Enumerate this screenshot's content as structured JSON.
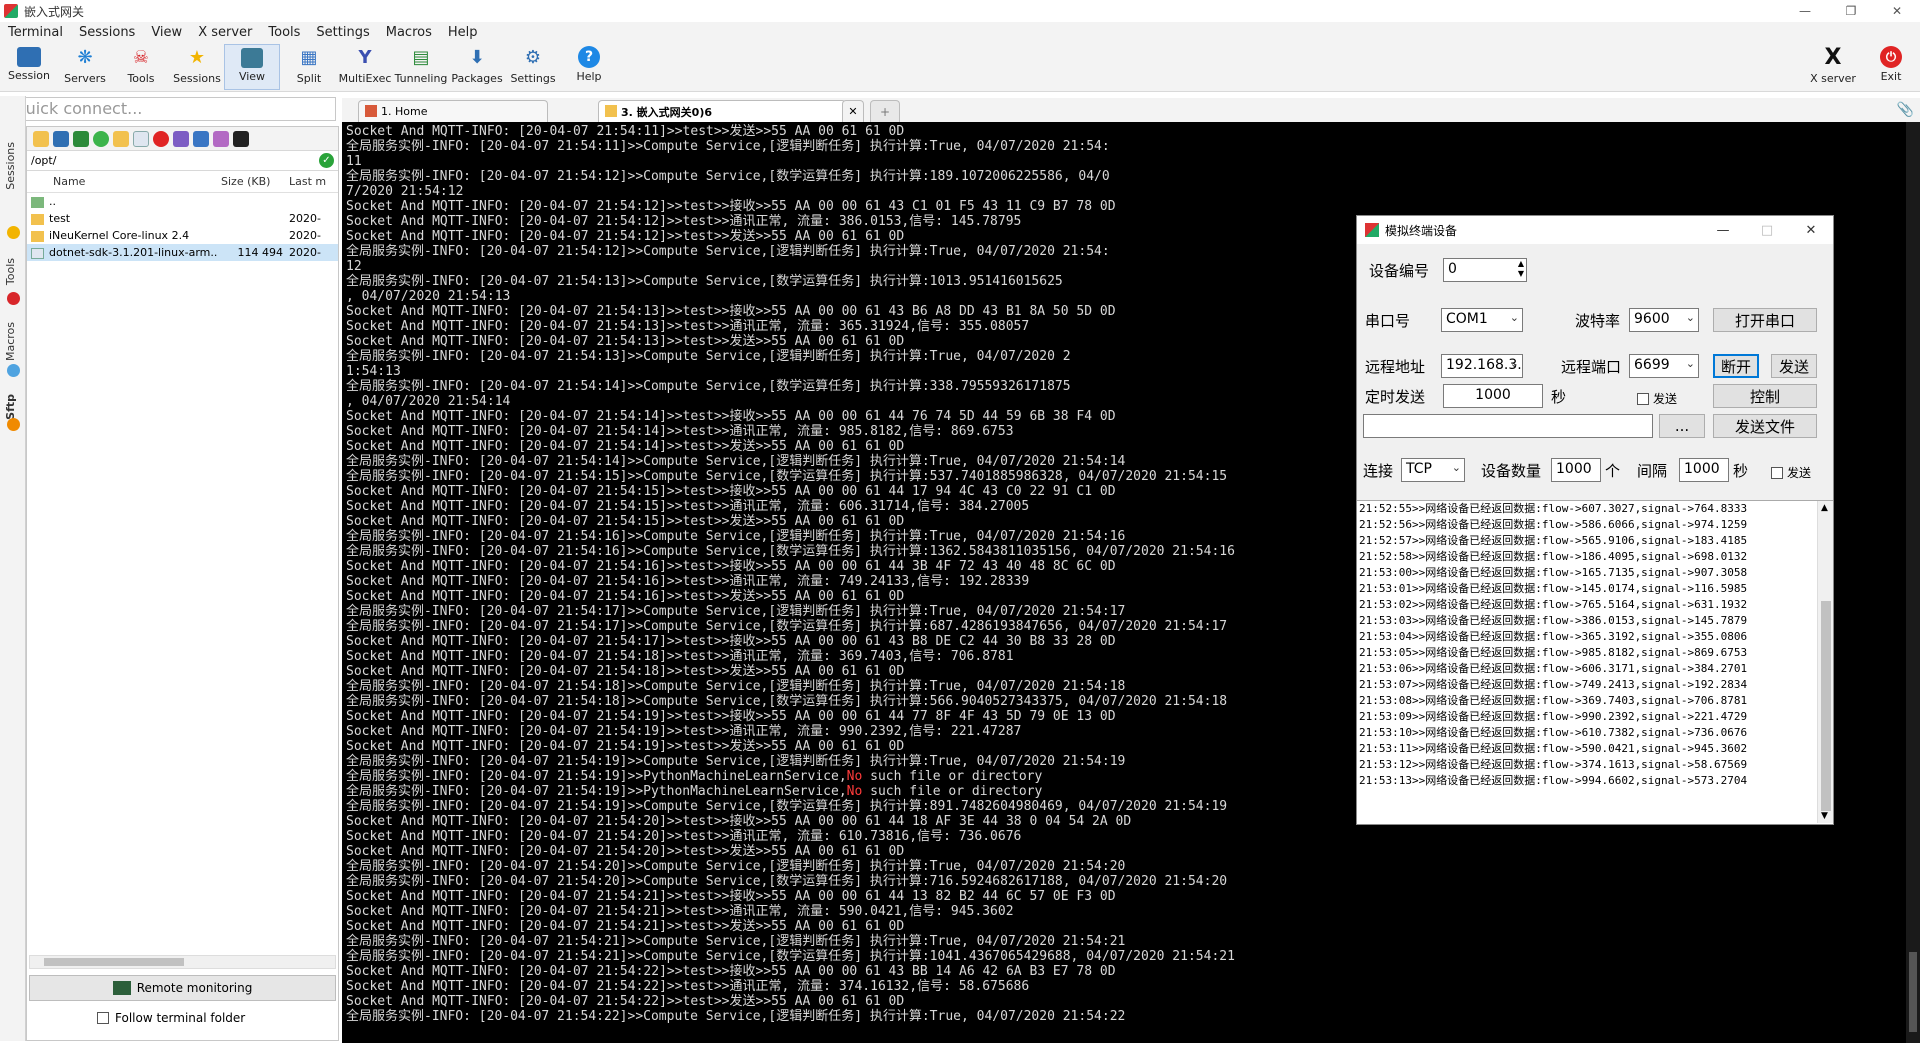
{
  "window": {
    "title": "嵌入式网关"
  },
  "menu": [
    "Terminal",
    "Sessions",
    "View",
    "X server",
    "Tools",
    "Settings",
    "Macros",
    "Help"
  ],
  "toolbar": {
    "session": "Session",
    "servers": "Servers",
    "tools": "Tools",
    "sessions": "Sessions",
    "view": "View",
    "split": "Split",
    "multiexec": "MultiExec",
    "tunneling": "Tunneling",
    "packages": "Packages",
    "settings": "Settings",
    "help": "Help",
    "xserver": "X server",
    "exit": "Exit"
  },
  "sidebar": {
    "quick_connect_placeholder": "Quick connect...",
    "vtabs": [
      "Sessions",
      "Tools",
      "Macros",
      "Sftp"
    ],
    "path": "/opt/",
    "columns": {
      "name": "Name",
      "size": "Size (KB)",
      "last": "Last m"
    },
    "files": [
      {
        "name": "..",
        "size": "",
        "last": "",
        "type": "parent"
      },
      {
        "name": "test",
        "size": "",
        "last": "2020-",
        "type": "folder"
      },
      {
        "name": "iNeuKernel Core-linux 2.4",
        "size": "",
        "last": "2020-",
        "type": "folder"
      },
      {
        "name": "dotnet-sdk-3.1.201-linux-arm...",
        "size": "114 494",
        "last": "2020-",
        "type": "file"
      }
    ],
    "remote_monitoring": "Remote monitoring",
    "follow_terminal": "Follow terminal folder"
  },
  "tabs": [
    {
      "label": "1. Home"
    },
    {
      "label": "3. 嵌入式网关0)6"
    }
  ],
  "terminal_lines": [
    "Socket And MQTT-INFO: [20-04-07 21:54:11]>>test>>发送>>55 AA 00 61 61 0D",
    "全局服务实例-INFO: [20-04-07 21:54:11]>>Compute Service,[逻辑判断任务] 执行计算:True, 04/07/2020 21:54:",
    "11",
    "全局服务实例-INFO: [20-04-07 21:54:12]>>Compute Service,[数学运算任务] 执行计算:189.1072006225586, 04/0",
    "7/2020 21:54:12",
    "Socket And MQTT-INFO: [20-04-07 21:54:12]>>test>>接收>>55 AA 00 00 61 43 C1 01 F5 43 11 C9 B7 78 0D",
    "Socket And MQTT-INFO: [20-04-07 21:54:12]>>test>>通讯正常, 流量: 386.0153,信号: 145.78795",
    "Socket And MQTT-INFO: [20-04-07 21:54:12]>>test>>发送>>55 AA 00 61 61 0D",
    "全局服务实例-INFO: [20-04-07 21:54:12]>>Compute Service,[逻辑判断任务] 执行计算:True, 04/07/2020 21:54:",
    "12",
    "全局服务实例-INFO: [20-04-07 21:54:13]>>Compute Service,[数学运算任务] 执行计算:1013.951416015625",
    ", 04/07/2020 21:54:13",
    "Socket And MQTT-INFO: [20-04-07 21:54:13]>>test>>接收>>55 AA 00 00 61 43 B6 A8 DD 43 B1 8A 50 5D 0D",
    "Socket And MQTT-INFO: [20-04-07 21:54:13]>>test>>通讯正常, 流量: 365.31924,信号: 355.08057",
    "Socket And MQTT-INFO: [20-04-07 21:54:13]>>test>>发送>>55 AA 00 61 61 0D",
    "全局服务实例-INFO: [20-04-07 21:54:13]>>Compute Service,[逻辑判断任务] 执行计算:True, 04/07/2020 2",
    "1:54:13",
    "全局服务实例-INFO: [20-04-07 21:54:14]>>Compute Service,[数学运算任务] 执行计算:338.79559326171875",
    ", 04/07/2020 21:54:14",
    "Socket And MQTT-INFO: [20-04-07 21:54:14]>>test>>接收>>55 AA 00 00 61 44 76 74 5D 44 59 6B 38 F4 0D",
    "Socket And MQTT-INFO: [20-04-07 21:54:14]>>test>>通讯正常, 流量: 985.8182,信号: 869.6753",
    "Socket And MQTT-INFO: [20-04-07 21:54:14]>>test>>发送>>55 AA 00 61 61 0D",
    "全局服务实例-INFO: [20-04-07 21:54:14]>>Compute Service,[逻辑判断任务] 执行计算:True, 04/07/2020 21:54:14",
    "全局服务实例-INFO: [20-04-07 21:54:15]>>Compute Service,[数学运算任务] 执行计算:537.7401885986328, 04/07/2020 21:54:15",
    "Socket And MQTT-INFO: [20-04-07 21:54:15]>>test>>接收>>55 AA 00 00 61 44 17 94 4C 43 C0 22 91 C1 0D",
    "Socket And MQTT-INFO: [20-04-07 21:54:15]>>test>>通讯正常, 流量: 606.31714,信号: 384.27005",
    "Socket And MQTT-INFO: [20-04-07 21:54:15]>>test>>发送>>55 AA 00 61 61 0D",
    "全局服务实例-INFO: [20-04-07 21:54:16]>>Compute Service,[逻辑判断任务] 执行计算:True, 04/07/2020 21:54:16",
    "全局服务实例-INFO: [20-04-07 21:54:16]>>Compute Service,[数学运算任务] 执行计算:1362.5843811035156, 04/07/2020 21:54:16",
    "Socket And MQTT-INFO: [20-04-07 21:54:16]>>test>>接收>>55 AA 00 00 61 44 3B 4F 72 43 40 48 8C 6C 0D",
    "Socket And MQTT-INFO: [20-04-07 21:54:16]>>test>>通讯正常, 流量: 749.24133,信号: 192.28339",
    "Socket And MQTT-INFO: [20-04-07 21:54:16]>>test>>发送>>55 AA 00 61 61 0D",
    "全局服务实例-INFO: [20-04-07 21:54:17]>>Compute Service,[逻辑判断任务] 执行计算:True, 04/07/2020 21:54:17",
    "全局服务实例-INFO: [20-04-07 21:54:17]>>Compute Service,[数学运算任务] 执行计算:687.4286193847656, 04/07/2020 21:54:17",
    "Socket And MQTT-INFO: [20-04-07 21:54:17]>>test>>接收>>55 AA 00 00 61 43 B8 DE C2 44 30 B8 33 28 0D",
    "Socket And MQTT-INFO: [20-04-07 21:54:18]>>test>>通讯正常, 流量: 369.7403,信号: 706.8781",
    "Socket And MQTT-INFO: [20-04-07 21:54:18]>>test>>发送>>55 AA 00 61 61 0D",
    "全局服务实例-INFO: [20-04-07 21:54:18]>>Compute Service,[逻辑判断任务] 执行计算:True, 04/07/2020 21:54:18",
    "全局服务实例-INFO: [20-04-07 21:54:18]>>Compute Service,[数学运算任务] 执行计算:566.9040527343375, 04/07/2020 21:54:18",
    "Socket And MQTT-INFO: [20-04-07 21:54:19]>>test>>接收>>55 AA 00 00 61 44 77 8F 4F 43 5D 79 0E 13 0D",
    "Socket And MQTT-INFO: [20-04-07 21:54:19]>>test>>通讯正常, 流量: 990.2392,信号: 221.47287",
    "Socket And MQTT-INFO: [20-04-07 21:54:19]>>test>>发送>>55 AA 00 61 61 0D",
    "全局服务实例-INFO: [20-04-07 21:54:19]>>Compute Service,[逻辑判断任务] 执行计算:True, 04/07/2020 21:54:19",
    "全局服务实例-INFO: [20-04-07 21:54:19]>>PythonMachineLearnService,No such file or directory",
    "全局服务实例-INFO: [20-04-07 21:54:19]>>PythonMachineLearnService,No such file or directory",
    "全局服务实例-INFO: [20-04-07 21:54:19]>>Compute Service,[数学运算任务] 执行计算:891.7482604980469, 04/07/2020 21:54:19",
    "Socket And MQTT-INFO: [20-04-07 21:54:20]>>test>>接收>>55 AA 00 00 61 44 18 AF 3E 44 38 0 04 54 2A 0D",
    "Socket And MQTT-INFO: [20-04-07 21:54:20]>>test>>通讯正常, 流量: 610.73816,信号: 736.0676",
    "Socket And MQTT-INFO: [20-04-07 21:54:20]>>test>>发送>>55 AA 00 61 61 0D",
    "全局服务实例-INFO: [20-04-07 21:54:20]>>Compute Service,[逻辑判断任务] 执行计算:True, 04/07/2020 21:54:20",
    "全局服务实例-INFO: [20-04-07 21:54:20]>>Compute Service,[数学运算任务] 执行计算:716.5924682617188, 04/07/2020 21:54:20",
    "Socket And MQTT-INFO: [20-04-07 21:54:21]>>test>>接收>>55 AA 00 00 61 44 13 82 B2 44 6C 57 0E F3 0D",
    "Socket And MQTT-INFO: [20-04-07 21:54:21]>>test>>通讯正常, 流量: 590.0421,信号: 945.3602",
    "Socket And MQTT-INFO: [20-04-07 21:54:21]>>test>>发送>>55 AA 00 61 61 0D",
    "全局服务实例-INFO: [20-04-07 21:54:21]>>Compute Service,[逻辑判断任务] 执行计算:True, 04/07/2020 21:54:21",
    "全局服务实例-INFO: [20-04-07 21:54:21]>>Compute Service,[数学运算任务] 执行计算:1041.4367065429688, 04/07/2020 21:54:21",
    "Socket And MQTT-INFO: [20-04-07 21:54:22]>>test>>接收>>55 AA 00 00 61 43 BB 14 A6 42 6A B3 E7 78 0D",
    "Socket And MQTT-INFO: [20-04-07 21:54:22]>>test>>通讯正常, 流量: 374.16132,信号: 58.675686",
    "Socket And MQTT-INFO: [20-04-07 21:54:22]>>test>>发送>>55 AA 00 61 61 0D",
    "全局服务实例-INFO: [20-04-07 21:54:22]>>Compute Service,[逻辑判断任务] 执行计算:True, 04/07/2020 21:54:22"
  ],
  "dialog": {
    "title": "模拟终端设备",
    "device_id_label": "设备编号",
    "device_id": "0",
    "serial_label": "串口号",
    "serial_port": "COM1",
    "baud_label": "波特率",
    "baud": "9600",
    "open_serial": "打开串口",
    "remote_addr_label": "远程地址",
    "remote_addr": "192.168.3.",
    "remote_port_label": "远程端口",
    "remote_port": "6699",
    "disconnect": "断开",
    "send": "发送",
    "timer_label": "定时发送",
    "timer_value": "1000",
    "seconds": "秒",
    "send_check": "发送",
    "control": "控制",
    "browse": "...",
    "send_file": "发送文件",
    "connect_label": "连接",
    "protocol": "TCP",
    "device_count_label": "设备数量",
    "device_count": "1000",
    "unit": "个",
    "interval_label": "间隔",
    "interval": "1000",
    "seconds2": "秒",
    "send_check2": "发送",
    "log": [
      "21:52:55>>网络设备已经返回数据:flow->607.3027,signal->764.8333",
      "21:52:56>>网络设备已经返回数据:flow->586.6066,signal->974.1259",
      "21:52:57>>网络设备已经返回数据:flow->565.9106,signal->183.4185",
      "21:52:58>>网络设备已经返回数据:flow->186.4095,signal->698.0132",
      "21:53:00>>网络设备已经返回数据:flow->165.7135,signal->907.3058",
      "21:53:01>>网络设备已经返回数据:flow->145.0174,signal->116.5985",
      "21:53:02>>网络设备已经返回数据:flow->765.5164,signal->631.1932",
      "21:53:03>>网络设备已经返回数据:flow->386.0153,signal->145.7879",
      "21:53:04>>网络设备已经返回数据:flow->365.3192,signal->355.0806",
      "21:53:05>>网络设备已经返回数据:flow->985.8182,signal->869.6753",
      "21:53:06>>网络设备已经返回数据:flow->606.3171,signal->384.2701",
      "21:53:07>>网络设备已经返回数据:flow->749.2413,signal->192.2834",
      "21:53:08>>网络设备已经返回数据:flow->369.7403,signal->706.8781",
      "21:53:09>>网络设备已经返回数据:flow->990.2392,signal->221.4729",
      "21:53:10>>网络设备已经返回数据:flow->610.7382,signal->736.0676",
      "21:53:11>>网络设备已经返回数据:flow->590.0421,signal->945.3602",
      "21:53:12>>网络设备已经返回数据:flow->374.1613,signal->58.67569",
      "21:53:13>>网络设备已经返回数据:flow->994.6602,signal->573.2704"
    ]
  }
}
